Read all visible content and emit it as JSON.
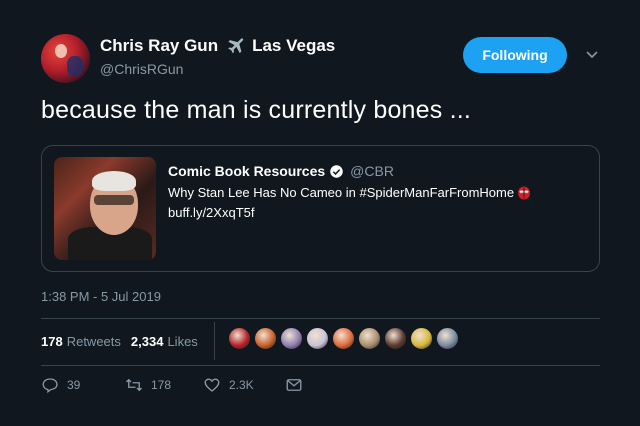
{
  "user": {
    "display_name": "Chris Ray Gun",
    "location": "Las Vegas",
    "handle": "@ChrisRGun"
  },
  "follow_button": {
    "label": "Following"
  },
  "tweet": {
    "text": "because the man is currently bones ..."
  },
  "quoted": {
    "name": "Comic Book Resources",
    "handle": "@CBR",
    "text": "Why Stan Lee Has No Cameo in #SpiderManFarFromHome",
    "link": "buff.ly/2XxqT5f"
  },
  "timestamp": "1:38 PM - 5 Jul 2019",
  "stats": {
    "retweets_count": "178",
    "retweets_label": "Retweets",
    "likes_count": "2,334",
    "likes_label": "Likes"
  },
  "likers": [
    {
      "color": "#b5232a"
    },
    {
      "color": "#c9602a"
    },
    {
      "color": "#8f7fb0"
    },
    {
      "color": "#c9c4d6"
    },
    {
      "color": "#e06a3a"
    },
    {
      "color": "#a89070"
    },
    {
      "color": "#5a3a30"
    },
    {
      "color": "#d8b83a"
    },
    {
      "color": "#7a8aa0"
    }
  ],
  "actions": {
    "reply_count": "39",
    "retweet_count": "178",
    "like_count": "2.3K"
  },
  "colors": {
    "background": "#10171e",
    "accent": "#1da1f2",
    "muted": "#8899a6",
    "border": "#38444d"
  }
}
